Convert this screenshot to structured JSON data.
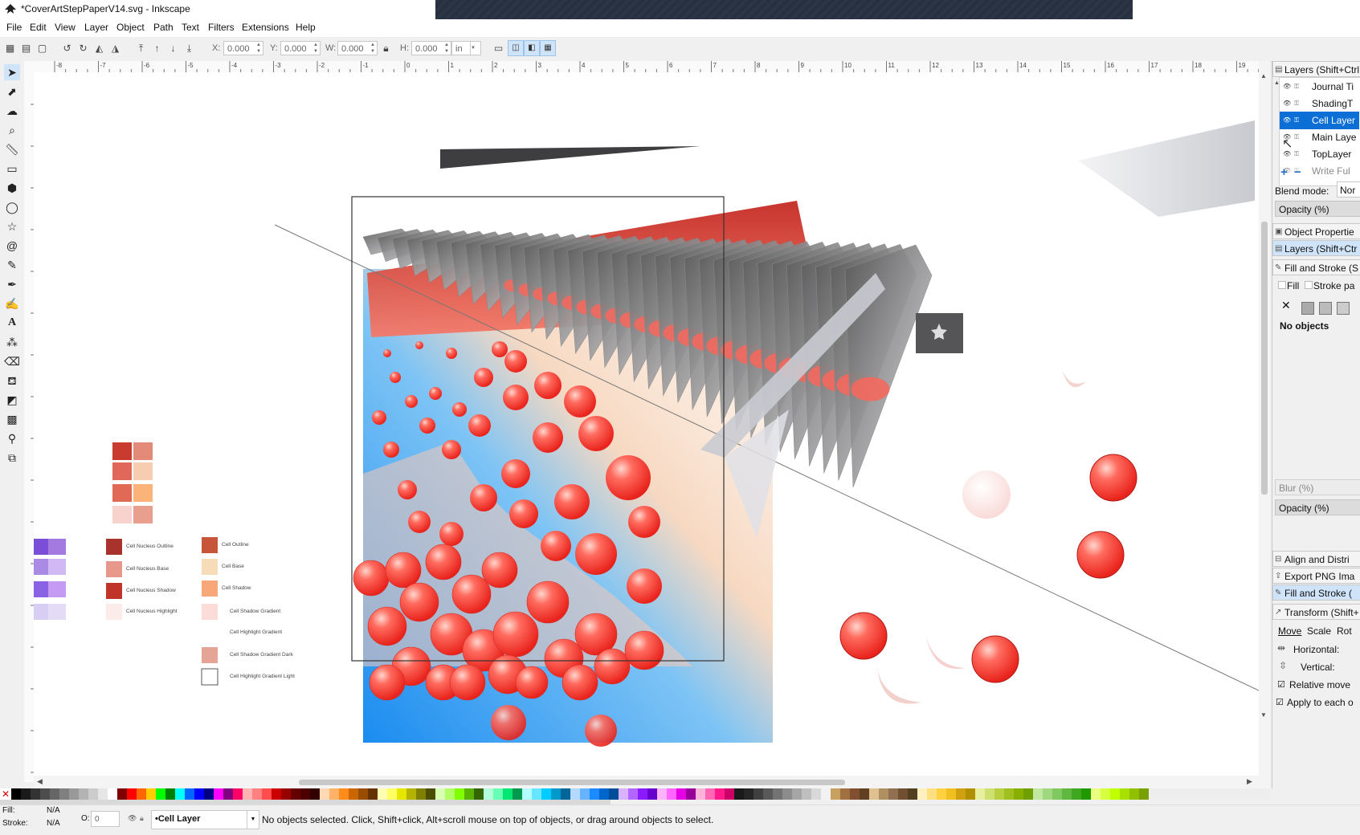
{
  "window": {
    "title": "*CoverArtStepPaperV14.svg - Inkscape"
  },
  "menu": [
    "File",
    "Edit",
    "View",
    "Layer",
    "Object",
    "Path",
    "Text",
    "Filters",
    "Extensions",
    "Help"
  ],
  "toolbar": {
    "x_label": "X:",
    "x_value": "0.000",
    "y_label": "Y:",
    "y_value": "0.000",
    "w_label": "W:",
    "w_value": "0.000",
    "h_label": "H:",
    "h_value": "0.000",
    "unit": "in"
  },
  "ruler": {
    "marks": [
      "-8",
      "-7",
      "-6",
      "-5",
      "-4",
      "-3",
      "-2",
      "-1",
      "0",
      "1",
      "2",
      "3",
      "4",
      "5",
      "6",
      "7",
      "8",
      "9",
      "10",
      "11",
      "12",
      "13",
      "14",
      "15",
      "16",
      "17",
      "18",
      "19"
    ]
  },
  "legend": {
    "labels": {
      "nucleus_outline": "Cell Nucleus Outline",
      "nucleus_base": "Cell Nucleus Base",
      "nucleus_shadow": "Cell Nucleus Shadow",
      "nucleus_highlight": "Cell Nucleus Highlight",
      "cell_outline": "Cell Outline",
      "cell_base": "Cell Base",
      "cell_shadow": "Cell Shadow",
      "cell_shadow_gradient": "Cell Shadow Gradient",
      "cell_highlight_gradient": "Cell Highlight Gradient",
      "cell_shadow_gradient_dark": "Cell Shadow Gradient Dark",
      "cell_highlight_gradient_light": "Cell Highlight Gradient Light"
    },
    "colors": {
      "nucleus_outline": "#a8322c",
      "nucleus_base": "#e8988a",
      "nucleus_shadow": "#c0342a",
      "nucleus_highlight": "#fbecea",
      "cell_outline": "#c6553a",
      "cell_base": "#f6dcb8",
      "cell_shadow": "#f8a878"
    }
  },
  "dock": {
    "layers_header": "Layers (Shift+Ctrl",
    "layers": [
      "Journal Ti",
      "ShadingT",
      "Cell Layer",
      "Main Laye",
      "TopLayer",
      "Write Ful"
    ],
    "selected_layer": "Cell Layer",
    "blend_label": "Blend mode:",
    "blend_value": "Nor",
    "opacity_label": "Opacity (%)",
    "tabs": [
      "Object Propertie",
      "Layers (Shift+Ctr",
      "Fill and Stroke (S"
    ],
    "fill_tab": "Fill",
    "stroke_paint_tab": "Stroke pa",
    "no_objects": "No objects",
    "blur_label": "Blur (%)",
    "opacity2_label": "Opacity (%)",
    "bottom_tabs": [
      "Align and Distri",
      "Export PNG Ima",
      "Fill and Stroke (",
      "Transform (Shift+"
    ],
    "transform_tabs": [
      "Move",
      "Scale",
      "Rot"
    ],
    "horizontal_label": "Horizontal:",
    "vertical_label": "Vertical:",
    "relative_move": "Relative move",
    "apply_each": "Apply to each o"
  },
  "status": {
    "fill_label": "Fill:",
    "fill_value": "N/A",
    "stroke_label": "Stroke:",
    "stroke_value": "N/A",
    "opacity_label": "O:",
    "opacity_value": "0",
    "layer_name": "•Cell Layer",
    "message": "No objects selected. Click, Shift+click, Alt+scroll mouse on top of objects, or drag around objects to select."
  },
  "palette_colors": [
    "#000000",
    "#1a1a1a",
    "#333333",
    "#4d4d4d",
    "#666666",
    "#808080",
    "#999999",
    "#b3b3b3",
    "#cccccc",
    "#e6e6e6",
    "#ffffff",
    "#800000",
    "#ff0000",
    "#ff6600",
    "#ffcc00",
    "#00ff00",
    "#008000",
    "#00ffff",
    "#0066ff",
    "#0000ff",
    "#000080",
    "#ff00ff",
    "#800080",
    "#ff0066",
    "#ffb3b3",
    "#ff8080",
    "#ff4d4d",
    "#cc0000",
    "#990000",
    "#660000",
    "#4d0000",
    "#330000",
    "#ffd9b3",
    "#ffb366",
    "#ff8c1a",
    "#cc6600",
    "#994d00",
    "#663300",
    "#ffffb3",
    "#ffff66",
    "#e6e600",
    "#b3b300",
    "#808000",
    "#4d4d00",
    "#d9ffb3",
    "#b3ff66",
    "#80ff00",
    "#59b300",
    "#336600",
    "#b3ffd9",
    "#66ffb3",
    "#00e673",
    "#00994d",
    "#b3ffff",
    "#66e6ff",
    "#00ccff",
    "#0099cc",
    "#006699",
    "#b3d9ff",
    "#66b3ff",
    "#1a8cff",
    "#0066cc",
    "#004d99",
    "#d9b3ff",
    "#b366ff",
    "#8c1aff",
    "#6600cc",
    "#ffb3ff",
    "#ff66ff",
    "#e600e6",
    "#990099",
    "#ffb3d9",
    "#ff66b3",
    "#ff1a8c",
    "#cc0066",
    "#1a1a1a",
    "#262626",
    "#404040",
    "#595959",
    "#737373",
    "#8c8c8c",
    "#a6a6a6",
    "#bfbfbf",
    "#d9d9d9",
    "#f2f2f2",
    "#c8a060",
    "#a07040",
    "#805030",
    "#604020",
    "#e0c090",
    "#b09060",
    "#907050",
    "#705030",
    "#504020",
    "#fff0c0",
    "#ffe080",
    "#ffd040",
    "#f0c020",
    "#d0a010",
    "#b09000",
    "#e8f0a0",
    "#d0e070",
    "#b8d040",
    "#a0c020",
    "#88b000",
    "#70a000",
    "#c0e8a0",
    "#a0d880",
    "#80c860",
    "#60b840",
    "#40a820",
    "#209800",
    "#eaff80",
    "#d6ff40",
    "#c0ff00",
    "#a8e000",
    "#90c000",
    "#78a000"
  ]
}
